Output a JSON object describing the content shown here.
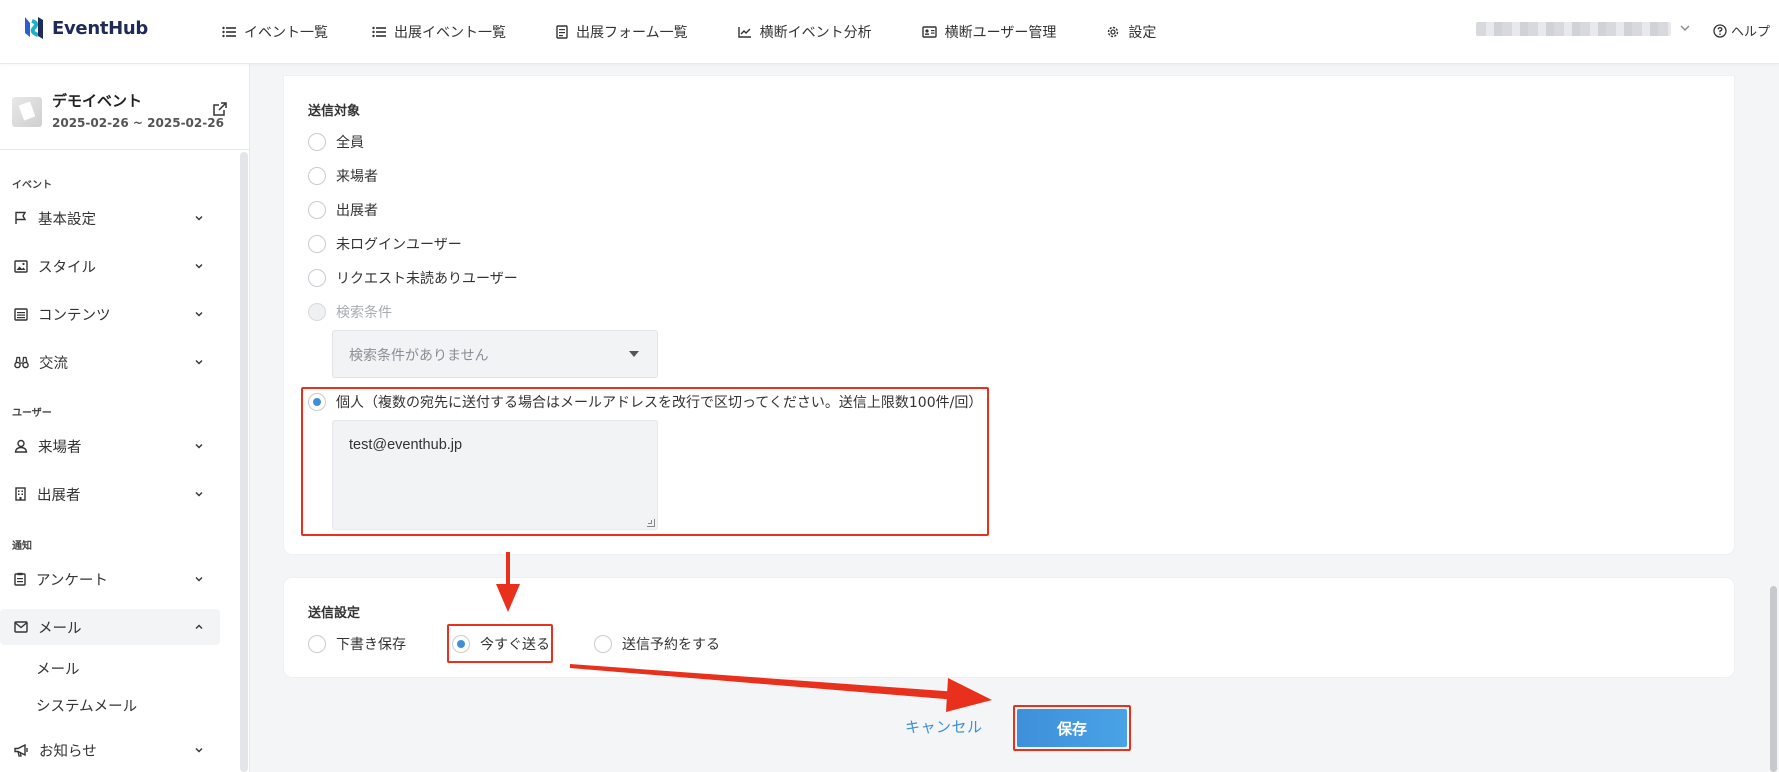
{
  "header": {
    "logo_text": "EventHub",
    "nav": [
      {
        "label": "イベント一覧",
        "icon": "list-icon"
      },
      {
        "label": "出展イベント一覧",
        "icon": "list-icon"
      },
      {
        "label": "出展フォーム一覧",
        "icon": "form-icon"
      },
      {
        "label": "横断イベント分析",
        "icon": "chart-icon"
      },
      {
        "label": "横断ユーザー管理",
        "icon": "id-card-icon"
      },
      {
        "label": "設定",
        "icon": "gear-icon"
      }
    ],
    "help_label": "ヘルプ"
  },
  "sidebar": {
    "event_title": "デモイベント",
    "event_dates": "2025-02-26 ~ 2025-02-26",
    "sections": {
      "event": "イベント",
      "user": "ユーザー",
      "notify": "通知"
    },
    "items": {
      "basic": "基本設定",
      "style": "スタイル",
      "contents": "コンテンツ",
      "exchange": "交流",
      "visitors": "来場者",
      "exhibitors": "出展者",
      "survey": "アンケート",
      "mail": "メール",
      "mail_sub": "メール",
      "system_mail": "システムメール",
      "news": "お知らせ"
    }
  },
  "target": {
    "label": "送信対象",
    "options": {
      "all": "全員",
      "visitors": "来場者",
      "exhibitors": "出展者",
      "not_logged": "未ログインユーザー",
      "unread_request": "リクエスト未読ありユーザー",
      "search": "検索条件",
      "individual": "個人（複数の宛先に送付する場合はメールアドレスを改行で区切ってください。送信上限数100件/回）"
    },
    "selected": "individual",
    "search_select_placeholder": "検索条件がありません",
    "recipients_value": "test@eventhub.jp"
  },
  "send_settings": {
    "label": "送信設定",
    "options": {
      "draft": "下書き保存",
      "now": "今すぐ送る",
      "schedule": "送信予約をする"
    },
    "selected": "now"
  },
  "actions": {
    "cancel": "キャンセル",
    "save": "保存"
  },
  "colors": {
    "accent": "#3d8fd9",
    "annotation": "#e8301c"
  }
}
